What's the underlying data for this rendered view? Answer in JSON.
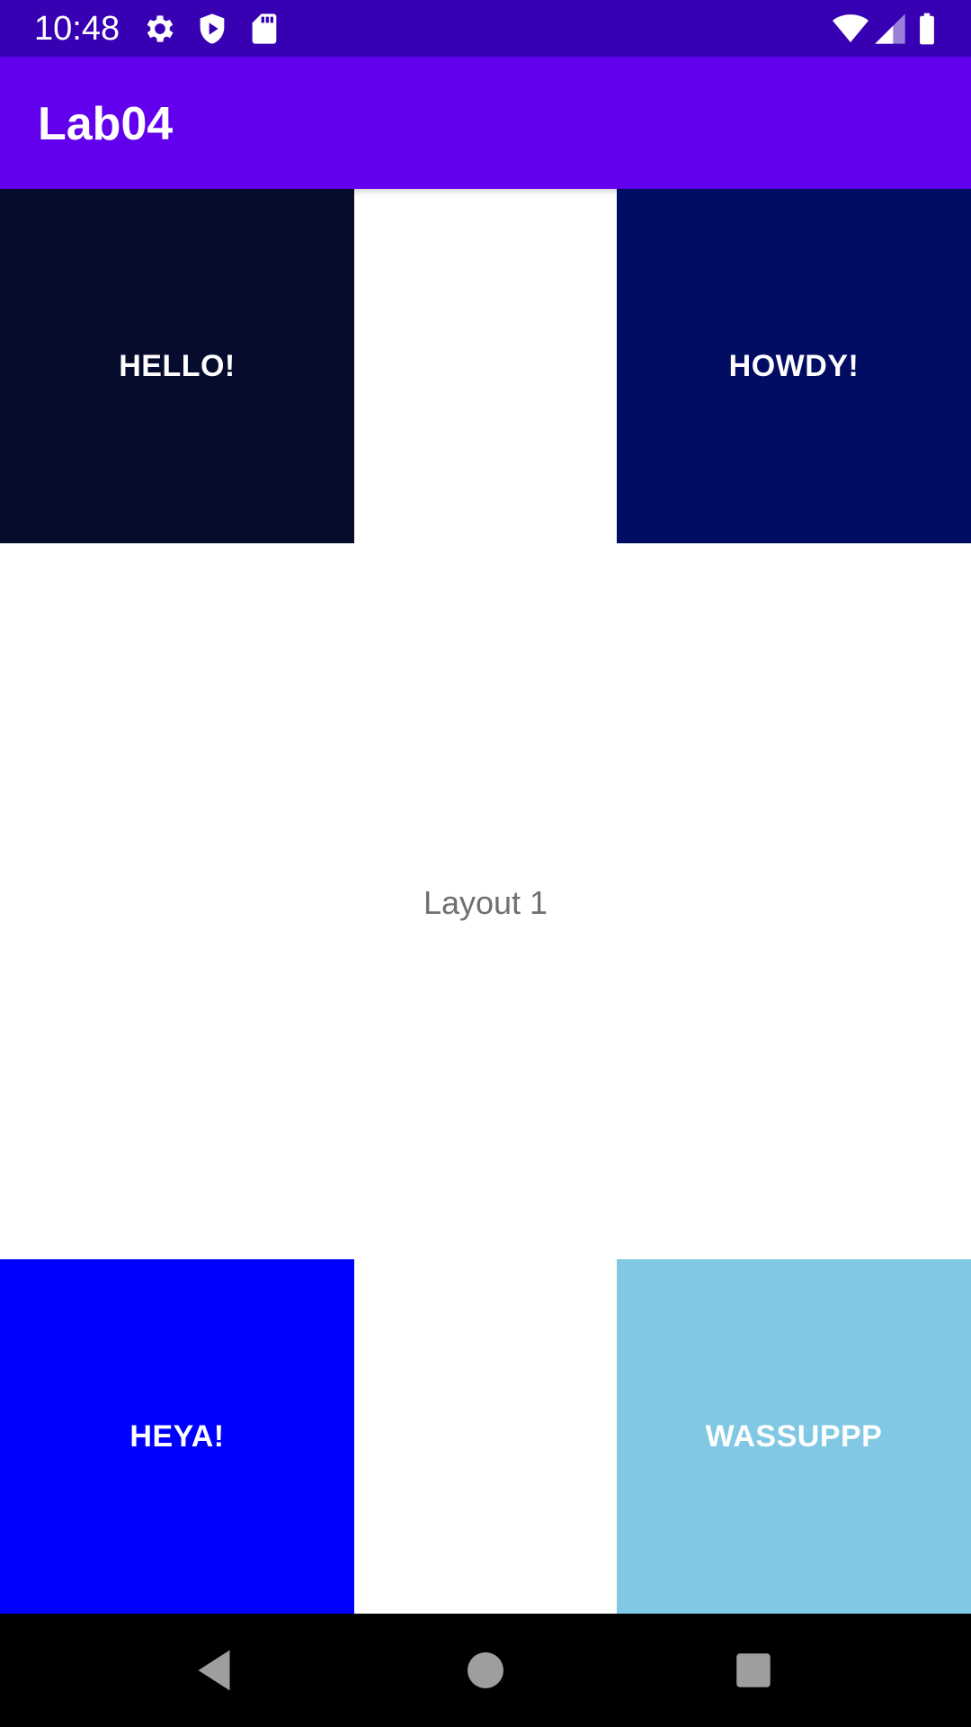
{
  "status_bar": {
    "time": "10:48",
    "icons": [
      "gear-icon",
      "shield-icon",
      "sd-card-icon",
      "wifi-icon",
      "signal-icon",
      "battery-icon"
    ]
  },
  "app_bar": {
    "title": "Lab04"
  },
  "tiles": {
    "hello": {
      "label": "HELLO!",
      "color": "#060d2c"
    },
    "howdy": {
      "label": "HOWDY!",
      "color": "#000d63"
    },
    "heya": {
      "label": "HEYA!",
      "color": "#0000ff"
    },
    "wassup": {
      "label": "WASSUPPP",
      "color": "#80c8e3"
    }
  },
  "main": {
    "layout_label": "Layout 1"
  },
  "nav_bar": {
    "icons": [
      "back-icon",
      "home-icon",
      "recents-icon"
    ]
  },
  "colors": {
    "status_bar": "#3700b3",
    "app_bar": "#6200ee",
    "background": "#ffffff"
  }
}
